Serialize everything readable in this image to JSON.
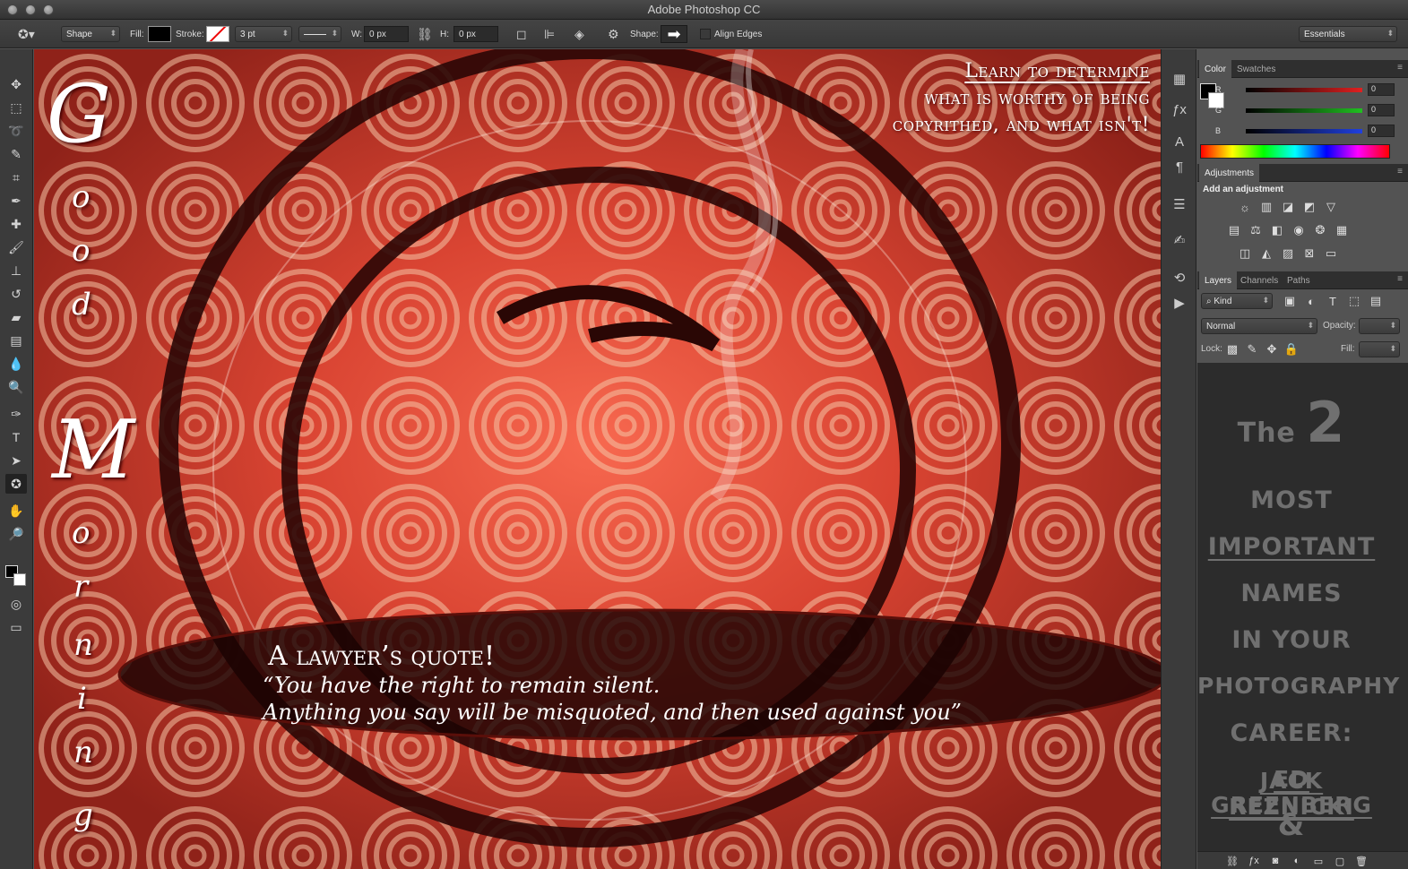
{
  "app": {
    "title": "Adobe Photoshop CC"
  },
  "options": {
    "mode": "Shape",
    "fill_label": "Fill:",
    "stroke_label": "Stroke:",
    "stroke_size": "3 pt",
    "w_label": "W:",
    "w_value": "0 px",
    "h_label": "H:",
    "h_value": "0 px",
    "shape_label": "Shape:",
    "align_edges_label": "Align Edges",
    "workspace": "Essentials"
  },
  "canvas": {
    "good_morning": [
      "G",
      "o",
      "o",
      "d",
      "M",
      "o",
      "r",
      "n",
      "i",
      "n",
      "g"
    ],
    "top_quote": [
      "Learn to determine",
      "what is worthy of being",
      "copyrithed, and what isn't!"
    ],
    "lawyer_title": "A lawyer’s quote!",
    "quote_lines": [
      "“You have the right to remain silent.",
      "Anything you say will be misquoted, and then used against you”"
    ]
  },
  "color_panel": {
    "tabs": [
      "Color",
      "Swatches"
    ],
    "channels": [
      {
        "label": "R",
        "value": "0",
        "color": "#e02020"
      },
      {
        "label": "G",
        "value": "0",
        "color": "#20c020"
      },
      {
        "label": "B",
        "value": "0",
        "color": "#2040e0"
      }
    ]
  },
  "adjustments_panel": {
    "tab": "Adjustments",
    "heading": "Add an adjustment"
  },
  "layers_panel": {
    "tabs": [
      "Layers",
      "Channels",
      "Paths"
    ],
    "kind_label": "Kind",
    "blend_mode": "Normal",
    "opacity_label": "Opacity:",
    "lock_label": "Lock:",
    "fill_label": "Fill:",
    "content": {
      "the": "The",
      "two": "2",
      "lines": [
        "MOST",
        "IMPORTANT",
        "NAMES",
        "IN YOUR",
        "PHOTOGRAPHY",
        "CAREER:",
        "ED GREENBERG",
        "&",
        "JACK REZNICKI"
      ]
    }
  },
  "colors": {
    "canvas_red": "#b83a2c",
    "dark_ring": "#2a0705",
    "panel_bg": "#535353"
  }
}
